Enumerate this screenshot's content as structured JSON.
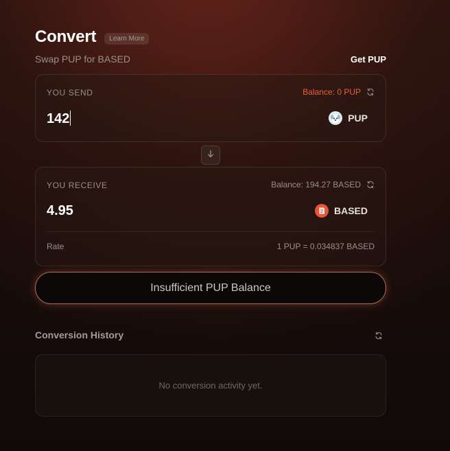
{
  "header": {
    "title": "Convert",
    "learn_more": "Learn More",
    "subtitle": "Swap PUP for BASED",
    "get_link": "Get PUP"
  },
  "send": {
    "label": "YOU SEND",
    "balance": "Balance: 0 PUP",
    "amount": "142",
    "token": "PUP"
  },
  "receive": {
    "label": "YOU RECEIVE",
    "balance": "Balance: 194.27 BASED",
    "amount": "4.95",
    "token": "BASED",
    "rate_label": "Rate",
    "rate_value": "1 PUP = 0.034837 BASED"
  },
  "action": {
    "label": "Insufficient PUP Balance"
  },
  "history": {
    "title": "Conversion History",
    "empty": "No conversion activity yet."
  },
  "colors": {
    "accent": "#e0613f",
    "based_token": "#e4553a",
    "pup_token": "#cfe3ea"
  },
  "icons": {
    "refresh": "refresh-icon",
    "swap": "arrow-down-icon",
    "pup": "pup-token-icon",
    "based": "based-token-icon"
  }
}
